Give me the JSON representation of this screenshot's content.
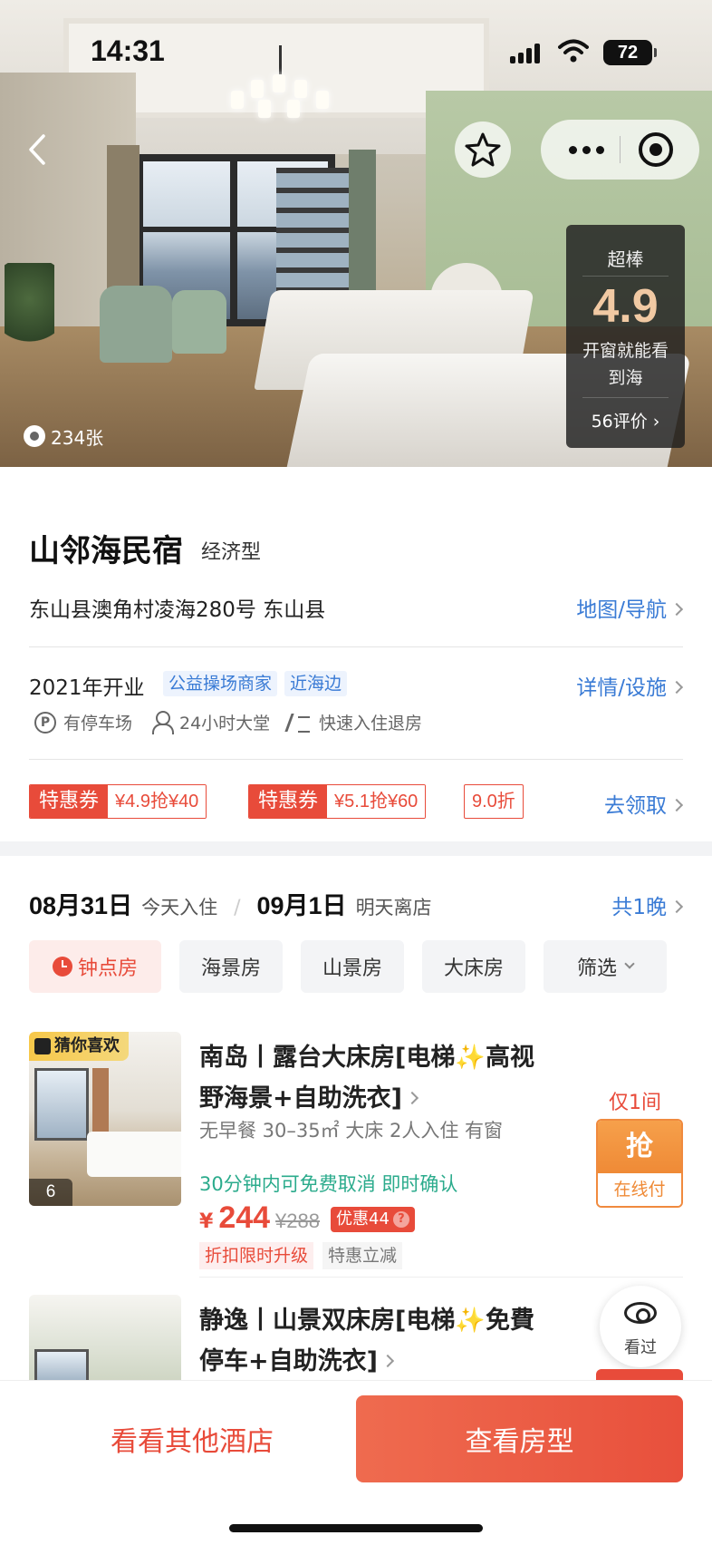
{
  "status_bar": {
    "time": "14:31",
    "battery": "72"
  },
  "hero": {
    "rating": {
      "label": "超棒",
      "score": "4.9",
      "tag": "开窗就能看到海",
      "reviews": "56评价"
    },
    "photo_count": "234张"
  },
  "hotel": {
    "name": "山邻海民宿",
    "type": "经济型",
    "address": "东山县澳角村凌海280号  东山县",
    "map_link": "地图/导航",
    "opened": "2021年开业",
    "tags": [
      "公益操场商家",
      "近海边"
    ],
    "details_link": "详情/设施",
    "facilities": [
      "有停车场",
      "24小时大堂",
      "快速入住退房"
    ]
  },
  "coupons": [
    {
      "label": "特惠券",
      "value": "¥4.9抢¥40"
    },
    {
      "label": "特惠券",
      "value": "¥5.1抢¥60"
    }
  ],
  "discount": "9.0折",
  "coupon_link": "去领取",
  "dates": {
    "checkin_date": "08月31日",
    "checkin_label": "今天入住",
    "checkout_date": "09月1日",
    "checkout_label": "明天离店",
    "nights": "共1晚"
  },
  "filters": [
    "钟点房",
    "海景房",
    "山景房",
    "大床房",
    "筛选"
  ],
  "rooms": [
    {
      "badge": "猜你喜欢",
      "photo_count": "6",
      "name": "南岛丨露台大床房[电梯✨高视野海景+自助洗衣]",
      "specs": "无早餐 30–35㎡ 大床 2人入住 有窗",
      "cancel": "30分钟内可免费取消  即时确认",
      "currency": "¥",
      "price": "244",
      "old_price": "¥288",
      "discount_badge": "优惠44",
      "promo_tags": [
        "折扣限时升级",
        "特惠立减"
      ],
      "stock": "仅1间",
      "book_main": "抢",
      "book_sub": "在线付"
    },
    {
      "name": "静逸丨山景双床房[电梯✨免費停车+自助洗衣]"
    }
  ],
  "viewed_label": "看过",
  "bottom": {
    "other_hotels": "看看其他酒店",
    "view_rooms": "查看房型"
  },
  "colors": {
    "accent": "#e84b3a",
    "link": "#3a7bd5",
    "green": "#2bab8c",
    "book_orange": "#ef8a36"
  }
}
